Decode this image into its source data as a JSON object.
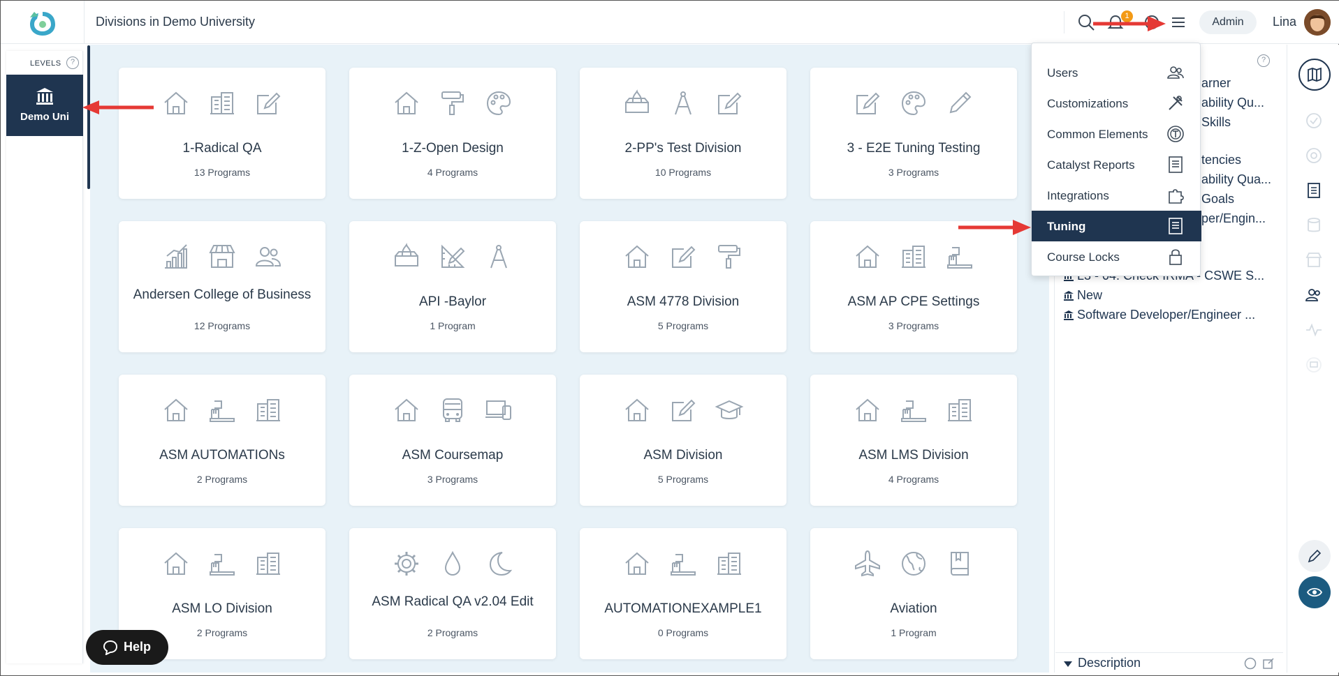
{
  "header": {
    "title": "Divisions in Demo University",
    "notification_count": "1",
    "role_label": "Admin",
    "user_name": "Lina"
  },
  "levels": {
    "label": "LEVELS",
    "help": "?",
    "active_label": "Demo Uni"
  },
  "cards": [
    {
      "title": "1-Radical QA",
      "count": "13 Programs",
      "icons": [
        "house-icon",
        "building-icon",
        "edit-icon"
      ]
    },
    {
      "title": "1-Z-Open Design",
      "count": "4 Programs",
      "icons": [
        "house-icon",
        "paint-roller-icon",
        "palette-icon"
      ]
    },
    {
      "title": "2-PP's Test Division",
      "count": "10 Programs",
      "icons": [
        "tissue-box-icon",
        "compass-icon",
        "edit-icon"
      ]
    },
    {
      "title": "3 - E2E Tuning Testing",
      "count": "3 Programs",
      "icons": [
        "edit-icon",
        "palette-icon",
        "pen-icon"
      ]
    },
    {
      "title": "Andersen College of Business",
      "count": "12 Programs",
      "icons": [
        "bar-chart-icon",
        "store-icon",
        "users-icon"
      ]
    },
    {
      "title": "API -Baylor",
      "count": "1 Program",
      "icons": [
        "tissue-box-icon",
        "ruler-pencil-icon",
        "compass-icon"
      ]
    },
    {
      "title": "ASM 4778 Division",
      "count": "5 Programs",
      "icons": [
        "house-icon",
        "edit-icon",
        "paint-roller-icon"
      ]
    },
    {
      "title": "ASM AP CPE Settings",
      "count": "3 Programs",
      "icons": [
        "house-icon",
        "building-icon",
        "toothbrush-icon"
      ]
    },
    {
      "title": "ASM AUTOMATIONs",
      "count": "2 Programs",
      "icons": [
        "house-icon",
        "toothbrush-icon",
        "building-icon"
      ]
    },
    {
      "title": "ASM Coursemap",
      "count": "3 Programs",
      "icons": [
        "house-icon",
        "bus-icon",
        "devices-icon"
      ]
    },
    {
      "title": "ASM Division",
      "count": "5 Programs",
      "icons": [
        "house-icon",
        "edit-icon",
        "graduation-cap-icon"
      ]
    },
    {
      "title": "ASM LMS Division",
      "count": "4 Programs",
      "icons": [
        "house-icon",
        "toothbrush-icon",
        "building-icon"
      ]
    },
    {
      "title": "ASM LO Division",
      "count": "2 Programs",
      "icons": [
        "house-icon",
        "toothbrush-icon",
        "building-icon"
      ]
    },
    {
      "title": "ASM Radical QA v2.04 Edit",
      "count": "2 Programs",
      "icons": [
        "gear-icon",
        "drop-icon",
        "moon-icon"
      ]
    },
    {
      "title": "AUTOMATIONEXAMPLE1",
      "count": "0 Programs",
      "icons": [
        "house-icon",
        "toothbrush-icon",
        "building-icon"
      ]
    },
    {
      "title": "Aviation",
      "count": "1 Program",
      "icons": [
        "plane-icon",
        "globe-icon",
        "book-icon"
      ]
    }
  ],
  "menu": {
    "items": [
      {
        "label": "Users",
        "icon": "users-icon",
        "active": false
      },
      {
        "label": "Customizations",
        "icon": "tools-icon",
        "active": false
      },
      {
        "label": "Common Elements",
        "icon": "t-circle-icon",
        "active": false
      },
      {
        "label": "Catalyst Reports",
        "icon": "report-icon",
        "active": false
      },
      {
        "label": "Integrations",
        "icon": "puzzle-icon",
        "active": false
      },
      {
        "label": "Tuning",
        "icon": "report-icon",
        "active": true
      },
      {
        "label": "Course Locks",
        "icon": "lock-icon",
        "active": false
      }
    ]
  },
  "right_panel": {
    "help": "?",
    "items": [
      "arner",
      "ability Qu...",
      "Skills",
      "tencies",
      "ability Qua...",
      "Goals",
      "per/Engin...",
      "L3 - 04. Check IRMA - CSWE S...",
      "New",
      "Software Developer/Engineer ..."
    ],
    "description_label": "Description"
  },
  "help_button": {
    "label": "Help"
  },
  "colors": {
    "navy": "#1f3550",
    "background": "#e8f2f8",
    "badge": "#f39a16",
    "arrow": "#e53935"
  }
}
